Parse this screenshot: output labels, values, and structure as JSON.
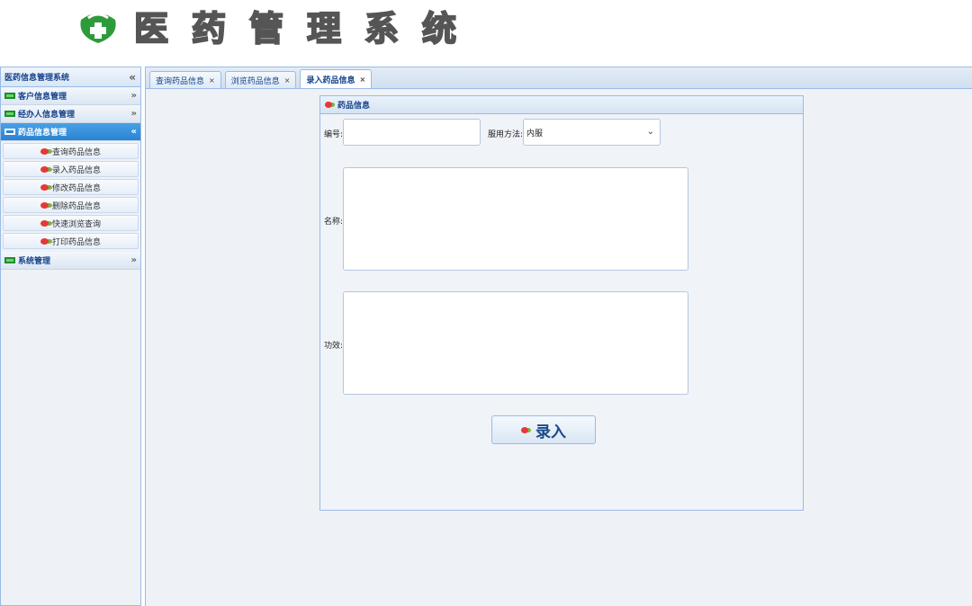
{
  "header": {
    "brand_chars": [
      "医",
      "药",
      "管",
      "理",
      "系",
      "统"
    ],
    "logo_icon": "green-cross-shield-icon"
  },
  "sidebar": {
    "title": "医药信息管理系统",
    "collapse_icon": "«",
    "groups": [
      {
        "label": "客户信息管理",
        "chevron": "»",
        "active": false
      },
      {
        "label": "经办人信息管理",
        "chevron": "»",
        "active": false
      },
      {
        "label": "药品信息管理",
        "chevron": "«",
        "active": true
      },
      {
        "label": "系统管理",
        "chevron": "»",
        "active": false
      }
    ],
    "items": [
      {
        "label": "查询药品信息"
      },
      {
        "label": "录入药品信息"
      },
      {
        "label": "修改药品信息"
      },
      {
        "label": "删除药品信息"
      },
      {
        "label": "快速浏览查询"
      },
      {
        "label": "打印药品信息"
      }
    ]
  },
  "tabs": [
    {
      "label": "查询药品信息",
      "close": "×"
    },
    {
      "label": "浏览药品信息",
      "close": "×"
    },
    {
      "label": "录入药品信息",
      "close": "×",
      "active": true
    }
  ],
  "panel": {
    "title": "药品信息",
    "fields": {
      "code_label": "编号:",
      "code_value": "",
      "usage_label": "服用方法:",
      "usage_value": "内服",
      "name_label": "名称:",
      "name_value": "",
      "effect_label": "功效:",
      "effect_value": ""
    },
    "submit_label": "录入"
  },
  "colors": {
    "accent": "#2a83d2",
    "border": "#99bbe8",
    "title_text": "#15428b"
  }
}
